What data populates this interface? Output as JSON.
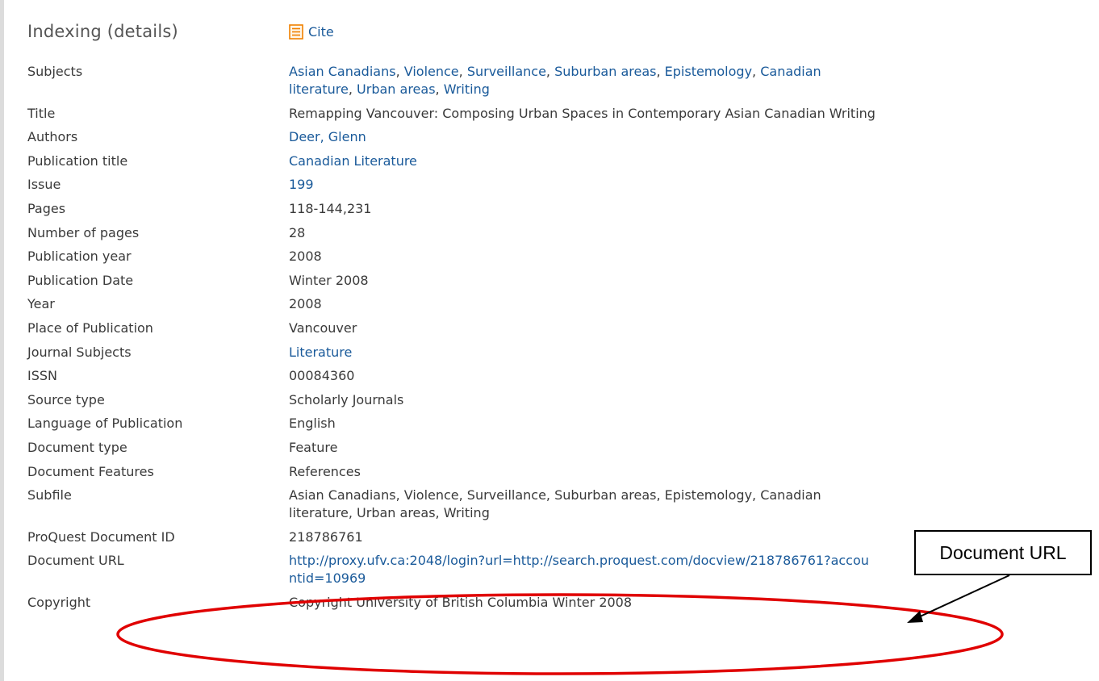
{
  "header": {
    "title": "Indexing (details)",
    "cite_label": "Cite"
  },
  "subjects": {
    "label": "Subjects",
    "links": [
      "Asian Canadians",
      "Violence",
      "Surveillance",
      "Suburban areas",
      "Epistemology",
      "Canadian literature",
      "Urban areas",
      "Writing"
    ]
  },
  "rows": [
    {
      "label": "Title",
      "value": "Remapping Vancouver: Composing Urban Spaces in Contemporary Asian Canadian Writing",
      "link": false
    },
    {
      "label": "Authors",
      "value": "Deer, Glenn",
      "link": true
    },
    {
      "label": "Publication title",
      "value": "Canadian Literature",
      "link": true
    },
    {
      "label": "Issue",
      "value": "199",
      "link": true
    },
    {
      "label": "Pages",
      "value": "118-144,231",
      "link": false
    },
    {
      "label": "Number of pages",
      "value": "28",
      "link": false
    },
    {
      "label": "Publication year",
      "value": "2008",
      "link": false
    },
    {
      "label": "Publication Date",
      "value": "Winter 2008",
      "link": false
    },
    {
      "label": "Year",
      "value": "2008",
      "link": false
    },
    {
      "label": "Place of Publication",
      "value": "Vancouver",
      "link": false
    },
    {
      "label": "Journal Subjects",
      "value": "Literature",
      "link": true
    },
    {
      "label": "ISSN",
      "value": "00084360",
      "link": false
    },
    {
      "label": "Source type",
      "value": "Scholarly Journals",
      "link": false
    },
    {
      "label": "Language of Publication",
      "value": "English",
      "link": false
    },
    {
      "label": "Document type",
      "value": "Feature",
      "link": false
    },
    {
      "label": "Document Features",
      "value": "References",
      "link": false
    },
    {
      "label": "Subfile",
      "value": "Asian Canadians, Violence, Surveillance, Suburban areas, Epistemology, Canadian literature, Urban areas, Writing",
      "link": false
    },
    {
      "label": "ProQuest Document ID",
      "value": "218786761",
      "link": false
    },
    {
      "label": "Document URL",
      "value": "http://proxy.ufv.ca:2048/login?url=http://search.proquest.com/docview/218786761?accountid=10969",
      "link": true
    },
    {
      "label": "Copyright",
      "value": "Copyright University of British Columbia Winter 2008",
      "link": false
    }
  ],
  "annotation": {
    "callout_text": "Document URL",
    "color": "#e00000"
  },
  "colors": {
    "link": "#1a5a9a",
    "text": "#3a3a3a",
    "cite_icon": "#f08000"
  }
}
